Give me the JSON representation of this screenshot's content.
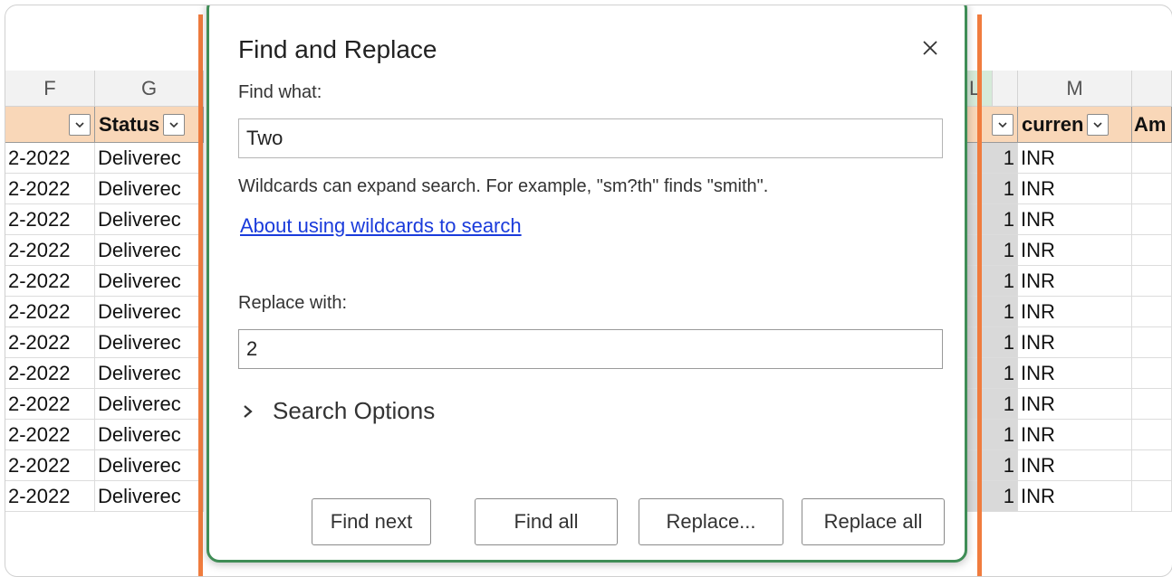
{
  "sheet": {
    "col_left": [
      "F",
      "G"
    ],
    "col_right_partial": "L",
    "col_m": "M",
    "header_left": {
      "status": "Status"
    },
    "header_right": {
      "currency": "curren",
      "amount": "Am"
    },
    "rows_left_date": [
      "2-2022",
      "2-2022",
      "2-2022",
      "2-2022",
      "2-2022",
      "2-2022",
      "2-2022",
      "2-2022",
      "2-2022",
      "2-2022",
      "2-2022",
      "2-2022"
    ],
    "rows_left_status": [
      "Deliverec",
      "Deliverec",
      "Deliverec",
      "Deliverec",
      "Deliverec",
      "Deliverec",
      "Deliverec",
      "Deliverec",
      "Deliverec",
      "Deliverec",
      "Deliverec",
      "Deliverec"
    ],
    "rows_right_qty": [
      "1",
      "1",
      "1",
      "1",
      "1",
      "1",
      "1",
      "1",
      "1",
      "1",
      "1",
      "1"
    ],
    "rows_right_currency": [
      "INR",
      "INR",
      "INR",
      "INR",
      "INR",
      "INR",
      "INR",
      "INR",
      "INR",
      "INR",
      "INR",
      "INR"
    ],
    "accent_orange": "#f07c3e",
    "table_header_color": "#f9d7b8"
  },
  "dialog": {
    "title": "Find and Replace",
    "close_icon": "close-icon",
    "find_label": "Find what:",
    "find_value": "Two",
    "hint": "Wildcards can expand search. For example, \"sm?th\" finds \"smith\".",
    "wildcards_link": "About using wildcards to search",
    "replace_label": "Replace with:",
    "replace_value": "2",
    "search_options": "Search Options",
    "buttons": {
      "find_next": "Find next",
      "find_all": "Find all",
      "replace": "Replace...",
      "replace_all": "Replace all"
    },
    "border_color": "#3f8d56",
    "link_color": "#1a3bdb"
  }
}
